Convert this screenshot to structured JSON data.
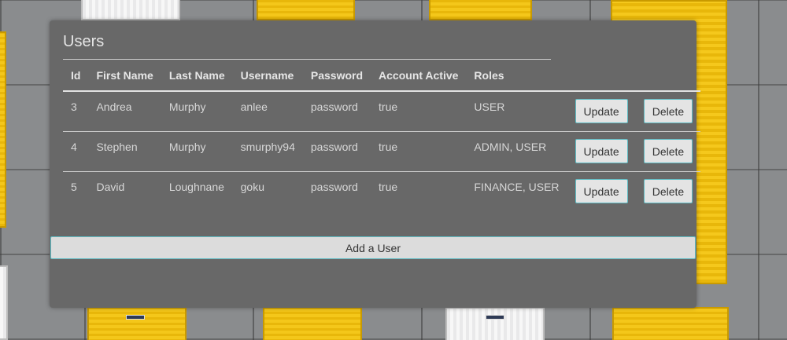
{
  "page": {
    "title": "Users"
  },
  "table": {
    "headers": [
      "Id",
      "First Name",
      "Last Name",
      "Username",
      "Password",
      "Account Active",
      "Roles"
    ],
    "rows": [
      {
        "id": "3",
        "first_name": "Andrea",
        "last_name": "Murphy",
        "username": "anlee",
        "password": "password",
        "active": "true",
        "roles": "USER"
      },
      {
        "id": "4",
        "first_name": "Stephen",
        "last_name": "Murphy",
        "username": "smurphy94",
        "password": "password",
        "active": "true",
        "roles": "ADMIN, USER"
      },
      {
        "id": "5",
        "first_name": "David",
        "last_name": "Loughnane",
        "username": "goku",
        "password": "password",
        "active": "true",
        "roles": "FINANCE, USER"
      }
    ],
    "update_label": "Update",
    "delete_label": "Delete"
  },
  "add_button_label": "Add a User",
  "colors": {
    "card_background": "#686868",
    "button_border": "#5fbcc4",
    "container_yellow": "#f4c71a"
  }
}
